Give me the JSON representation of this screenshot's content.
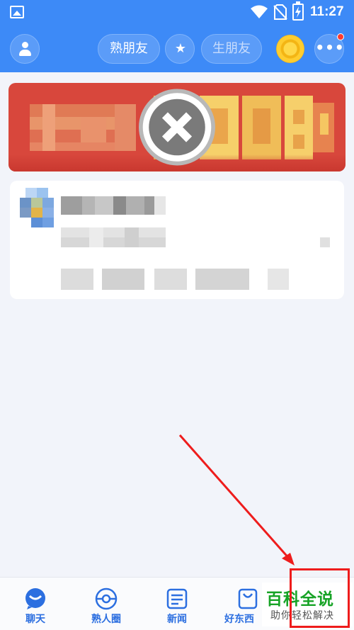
{
  "status_bar": {
    "time": "11:27"
  },
  "header": {
    "friends_tab": "熟朋友",
    "strangers_tab": "生朋友",
    "icons": [
      "avatar-icon",
      "star-icon",
      "coin-icon",
      "more-icon"
    ]
  },
  "tabbar": {
    "items": [
      {
        "label": "聊天",
        "icon": "chat-bubble-icon"
      },
      {
        "label": "熟人圈",
        "icon": "circle-icon"
      },
      {
        "label": "新闻",
        "icon": "news-icon"
      },
      {
        "label": "好东西",
        "icon": "shopping-bag-icon"
      }
    ]
  },
  "watermark": {
    "line1": "百科全说",
    "line2": "助你轻松解决"
  },
  "colors": {
    "brand": "#3d8af7",
    "tab_active": "#2c6fe0",
    "annotation": "#ee1c1c",
    "watermark": "#17a326"
  }
}
